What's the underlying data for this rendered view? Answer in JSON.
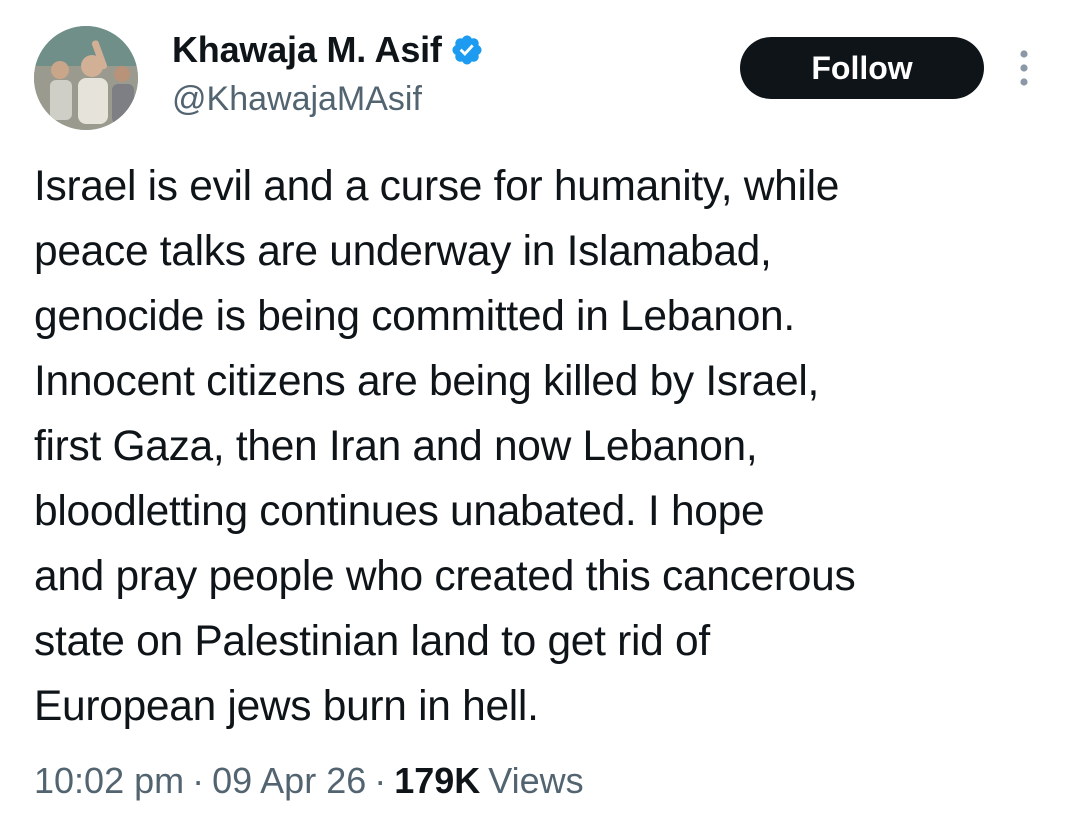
{
  "author": {
    "display_name": "Khawaja M. Asif",
    "handle": "@KhawajaMAsif",
    "verified": true,
    "verified_color": "#1d9bf0",
    "avatar_icon": "profile-photo"
  },
  "actions": {
    "follow_label": "Follow",
    "more_icon": "vertical-ellipsis-icon"
  },
  "tweet": {
    "lines": [
      "Israel is evil and a curse for humanity, while",
      "peace talks are underway in Islamabad,",
      "genocide is being committed in Lebanon.",
      "Innocent citizens are being killed by Israel,",
      "first Gaza, then Iran and now Lebanon,",
      "bloodletting continues unabated. I hope",
      "and pray people who created this cancerous",
      "state on Palestinian land to get rid of",
      "European jews burn in hell."
    ]
  },
  "meta": {
    "time": "10:02 pm",
    "separator": "·",
    "date": "09 Apr 26",
    "views_count": "179K",
    "views_label": "Views"
  },
  "colors": {
    "text": "#0f1419",
    "secondary_text": "#536471",
    "button_bg": "#0f1419",
    "button_text": "#ffffff"
  }
}
